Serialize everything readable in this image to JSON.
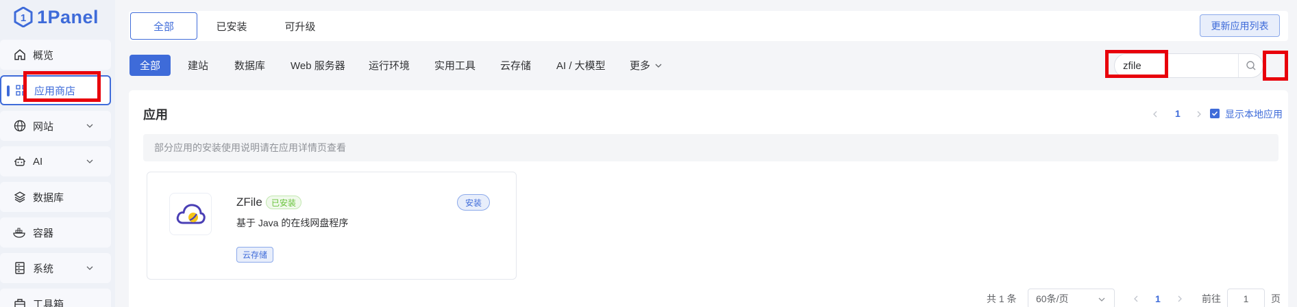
{
  "app": {
    "logo_text": "1Panel"
  },
  "sidebar": {
    "items": [
      {
        "label": "概览",
        "icon": "home-icon",
        "has_chevron": false
      },
      {
        "label": "应用商店",
        "icon": "grid-icon",
        "has_chevron": false,
        "active": true
      },
      {
        "label": "网站",
        "icon": "globe-icon",
        "has_chevron": true
      },
      {
        "label": "AI",
        "icon": "robot-icon",
        "has_chevron": true
      },
      {
        "label": "数据库",
        "icon": "layers-icon",
        "has_chevron": false
      },
      {
        "label": "容器",
        "icon": "container-icon",
        "has_chevron": false
      },
      {
        "label": "系统",
        "icon": "server-icon",
        "has_chevron": true
      },
      {
        "label": "工具箱",
        "icon": "toolbox-icon",
        "has_chevron": false
      }
    ]
  },
  "top_tabs": [
    {
      "label": "全部",
      "active": true
    },
    {
      "label": "已安装",
      "active": false
    },
    {
      "label": "可升级",
      "active": false
    }
  ],
  "update_list_button": "更新应用列表",
  "categories": [
    {
      "label": "全部",
      "active": true
    },
    {
      "label": "建站"
    },
    {
      "label": "数据库"
    },
    {
      "label": "Web 服务器"
    },
    {
      "label": "运行环境"
    },
    {
      "label": "实用工具"
    },
    {
      "label": "云存储"
    },
    {
      "label": "AI / 大模型"
    },
    {
      "label": "更多"
    }
  ],
  "search": {
    "value": "zfile",
    "icon": "search-icon"
  },
  "panel": {
    "title": "应用",
    "current_page": "1",
    "show_local_label": "显示本地应用",
    "show_local_checked": true,
    "notice": "部分应用的安装使用说明请在应用详情页查看"
  },
  "apps": [
    {
      "name": "ZFile",
      "status_badge": "已安装",
      "action_label": "安装",
      "description": "基于 Java 的在线网盘程序",
      "tag": "云存储",
      "icon": "cloud-icon"
    }
  ],
  "footer": {
    "total": "共 1 条",
    "page_size": "60条/页",
    "current_page": "1",
    "goto_label": "前往",
    "goto_value": "1",
    "page_suffix": "页"
  },
  "colors": {
    "accent": "#3e6bd9",
    "highlight_box": "#e8000b",
    "installed_green": "#67c23a"
  }
}
